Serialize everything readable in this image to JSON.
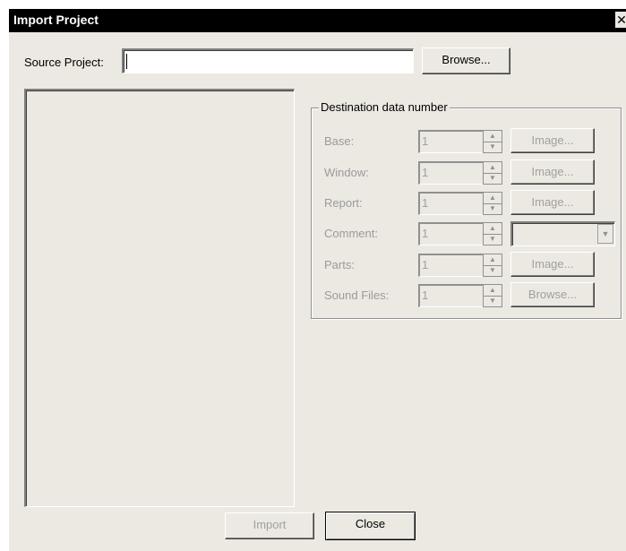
{
  "window": {
    "title": "Import Project"
  },
  "source": {
    "label": "Source Project:",
    "value": "",
    "browse_label": "Browse..."
  },
  "destination": {
    "group_label": "Destination data number",
    "rows": [
      {
        "label": "Base:",
        "value": "1",
        "button_label": "Image..."
      },
      {
        "label": "Window:",
        "value": "1",
        "button_label": "Image..."
      },
      {
        "label": "Report:",
        "value": "1",
        "button_label": "Image..."
      },
      {
        "label": "Comment:",
        "value": "1",
        "select_value": ""
      },
      {
        "label": "Parts:",
        "value": "1",
        "button_label": "Image..."
      },
      {
        "label": "Sound Files:",
        "value": "1",
        "button_label": "Browse..."
      }
    ]
  },
  "footer": {
    "import_label": "Import",
    "close_label": "Close"
  },
  "icons": {
    "close": "close-icon",
    "spin_up": "spin-up-icon",
    "spin_down": "spin-down-icon",
    "dropdown": "chevron-down-icon"
  }
}
